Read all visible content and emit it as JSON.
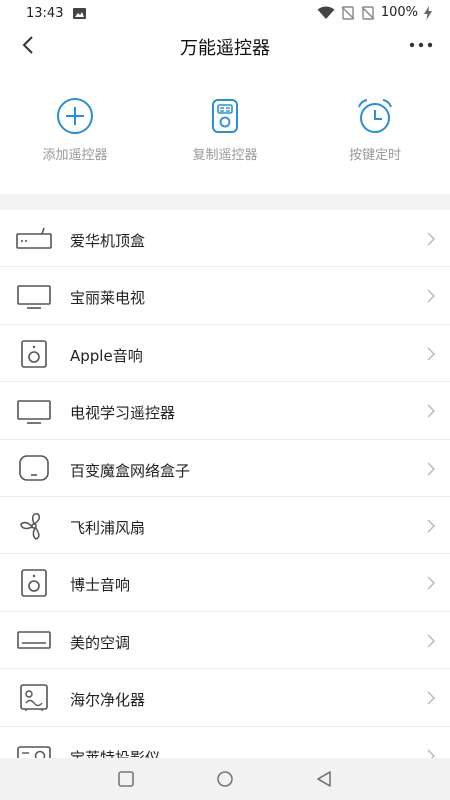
{
  "status_bar": {
    "time": "13:43",
    "battery": "100%"
  },
  "header": {
    "title": "万能遥控器"
  },
  "actions": [
    {
      "label": "添加遥控器",
      "icon": "add-circle-icon"
    },
    {
      "label": "复制遥控器",
      "icon": "remote-copy-icon"
    },
    {
      "label": "按键定时",
      "icon": "alarm-clock-icon"
    }
  ],
  "devices": [
    {
      "label": "爱华机顶盒",
      "icon": "set-top-box-icon"
    },
    {
      "label": "宝丽莱电视",
      "icon": "tv-icon"
    },
    {
      "label": "Apple音响",
      "icon": "speaker-icon"
    },
    {
      "label": "电视学习遥控器",
      "icon": "tv-icon"
    },
    {
      "label": "百变魔盒网络盒子",
      "icon": "network-box-icon"
    },
    {
      "label": "飞利浦风扇",
      "icon": "fan-icon"
    },
    {
      "label": "博士音响",
      "icon": "speaker-icon"
    },
    {
      "label": "美的空调",
      "icon": "air-conditioner-icon"
    },
    {
      "label": "海尔净化器",
      "icon": "purifier-icon"
    },
    {
      "label": "宝莱特投影仪",
      "icon": "projector-icon"
    }
  ],
  "colors": {
    "accent": "#2b8fd6",
    "action_label": "#999999",
    "icon_gray": "#555555"
  }
}
